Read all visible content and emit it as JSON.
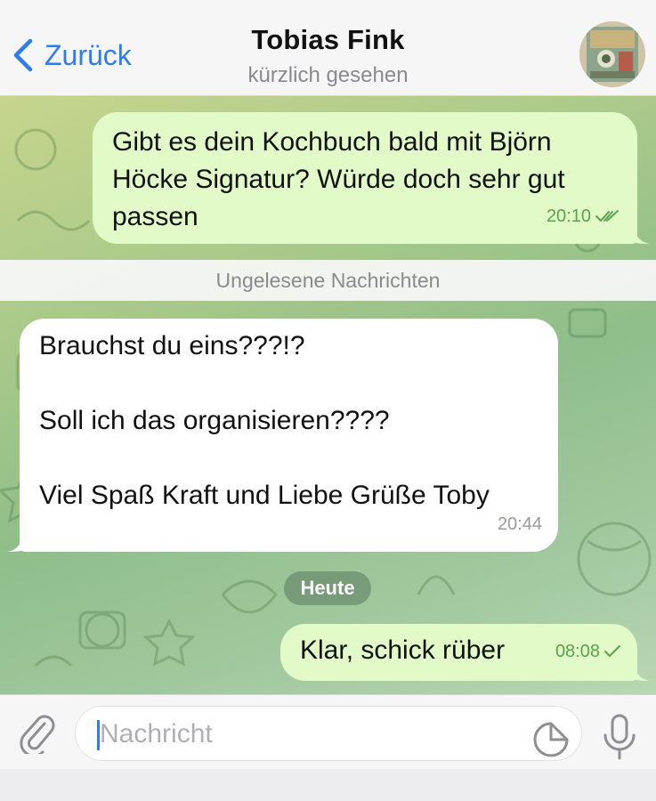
{
  "header": {
    "back_label": "Zurück",
    "contact_name": "Tobias Fink",
    "status": "kürzlich gesehen"
  },
  "messages": [
    {
      "direction": "outgoing",
      "text": "Gibt es dein Kochbuch bald mit Björn\nHöcke Signatur? Würde doch sehr gut\npassen",
      "time": "20:10",
      "read": true
    },
    {
      "direction": "incoming",
      "text": "Brauchst du eins???!?\n\nSoll ich das organisieren????\n\nViel Spaß Kraft und Liebe Grüße Toby",
      "time": "20:44"
    },
    {
      "direction": "outgoing",
      "text": "Klar, schick rüber",
      "time": "08:08",
      "read": false
    }
  ],
  "separators": {
    "unread": "Ungelesene Nachrichten",
    "date": "Heute"
  },
  "composer": {
    "placeholder": "Nachricht"
  },
  "icons": {
    "back": "chevron-left-icon",
    "attach": "paperclip-icon",
    "sticker": "sticker-icon",
    "mic": "microphone-icon",
    "double_check": "double-check-icon",
    "single_check": "check-icon"
  },
  "colors": {
    "accent": "#2f7bf0",
    "outgoing_bubble": "#e2f9c8",
    "incoming_bubble": "#ffffff",
    "check_green": "#59a34f",
    "chat_background": "#a9c98a"
  }
}
